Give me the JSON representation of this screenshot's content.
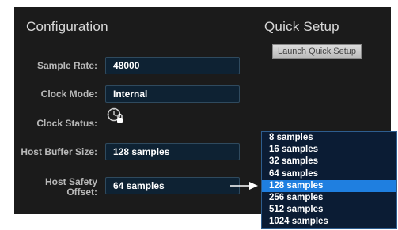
{
  "configuration": {
    "heading": "Configuration",
    "sample_rate": {
      "label": "Sample Rate:",
      "value": "48000"
    },
    "clock_mode": {
      "label": "Clock Mode:",
      "value": "Internal"
    },
    "clock_status": {
      "label": "Clock Status:",
      "icon": "clock-locked-icon"
    },
    "host_buffer_size": {
      "label": "Host Buffer Size:",
      "value": "128 samples"
    },
    "host_safety_offset": {
      "label_line1": "Host Safety",
      "label_line2": "Offset:",
      "value": "64 samples"
    }
  },
  "quick_setup": {
    "heading": "Quick Setup",
    "button_label": "Launch Quick Setup"
  },
  "buffer_dropdown": {
    "options": [
      "8 samples",
      "16 samples",
      "32 samples",
      "64 samples",
      "128 samples",
      "256 samples",
      "512 samples",
      "1024 samples"
    ],
    "selected": "128 samples"
  },
  "colors": {
    "panel_bg": "#1b1b1b",
    "field_bg": "#0e2233",
    "dropdown_bg": "#0b1c34",
    "selected_option": "#1f7fe0"
  }
}
